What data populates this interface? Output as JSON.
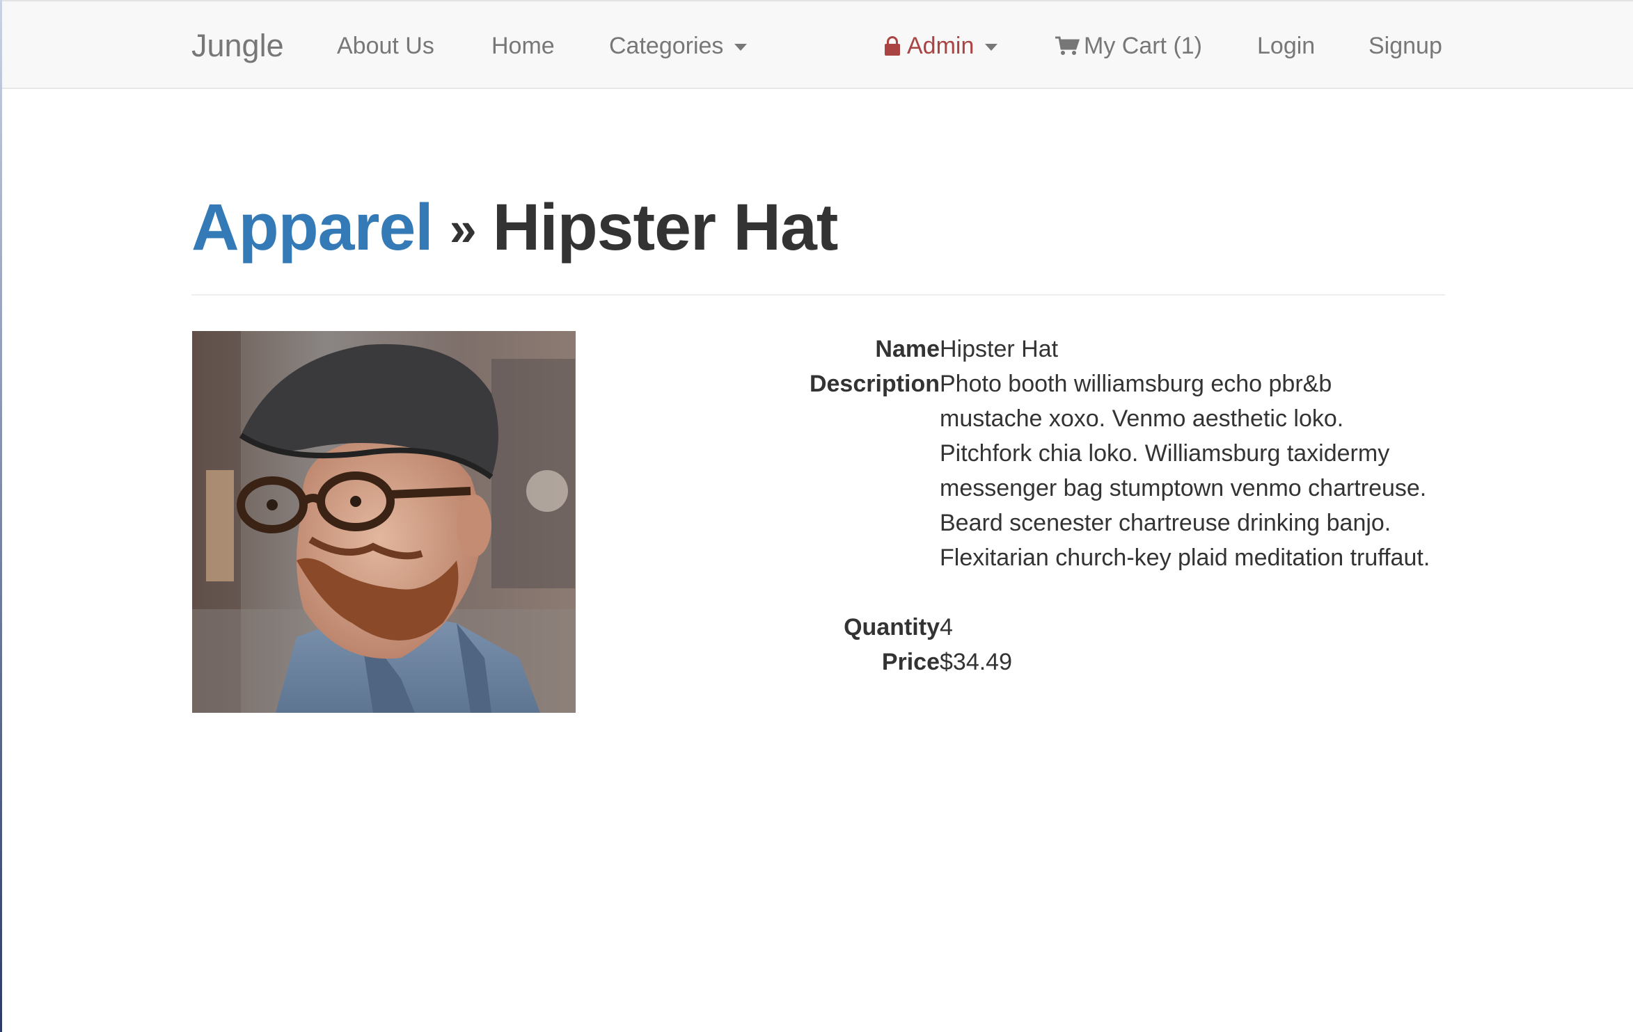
{
  "nav": {
    "brand": "Jungle",
    "about": "About Us",
    "home": "Home",
    "categories": "Categories",
    "admin": "Admin",
    "cart": "My Cart (1)",
    "login": "Login",
    "signup": "Signup"
  },
  "breadcrumb": {
    "category": "Apparel",
    "separator": "»",
    "product": "Hipster Hat"
  },
  "product": {
    "labels": {
      "name": "Name",
      "description": "Description",
      "quantity": "Quantity",
      "price": "Price"
    },
    "name": "Hipster Hat",
    "description": "Photo booth williamsburg echo pbr&b mustache xoxo. Venmo aesthetic loko. Pitchfork chia loko. Williamsburg taxidermy messenger bag stumptown venmo chartreuse. Beard scenester chartreuse drinking banjo. Flexitarian church-key plaid meditation truffaut.",
    "quantity": "4",
    "price": "$34.49"
  },
  "colors": {
    "link": "#337ab7",
    "admin": "#a94442",
    "nav_text": "#777777",
    "navbar_bg": "#f8f8f8"
  },
  "icons": {
    "admin": "lock-icon",
    "cart": "shopping-cart-icon",
    "dropdown": "caret-down-icon"
  }
}
